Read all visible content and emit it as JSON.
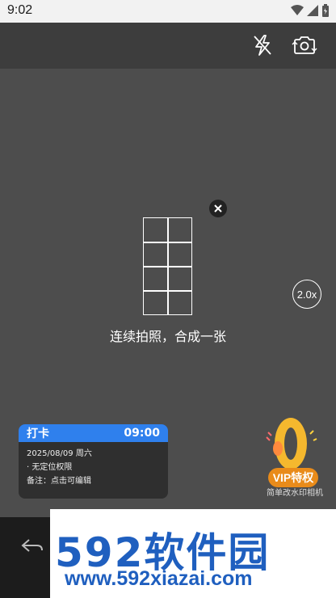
{
  "status_bar": {
    "time": "9:02",
    "icons": [
      "wifi-icon",
      "signal-icon",
      "battery-icon"
    ]
  },
  "topbar": {
    "icons": [
      "flash-off-icon",
      "camera-switch-icon"
    ]
  },
  "viewfinder": {
    "hint": "连续拍照，合成一张",
    "zoom": "2.0x"
  },
  "card": {
    "title": "打卡",
    "time": "09:00",
    "date": "2025/08/09 周六",
    "location": "· 无定位权限",
    "note": "备注：点击可编辑",
    "accent": "#2f80ed"
  },
  "vip": {
    "number": "0",
    "badge": "VIP特权",
    "subtitle": "简单改水印相机"
  },
  "watermark": {
    "logo": "592软件园",
    "url": "www.592xiazai.com",
    "color": "#1f5fbf"
  }
}
